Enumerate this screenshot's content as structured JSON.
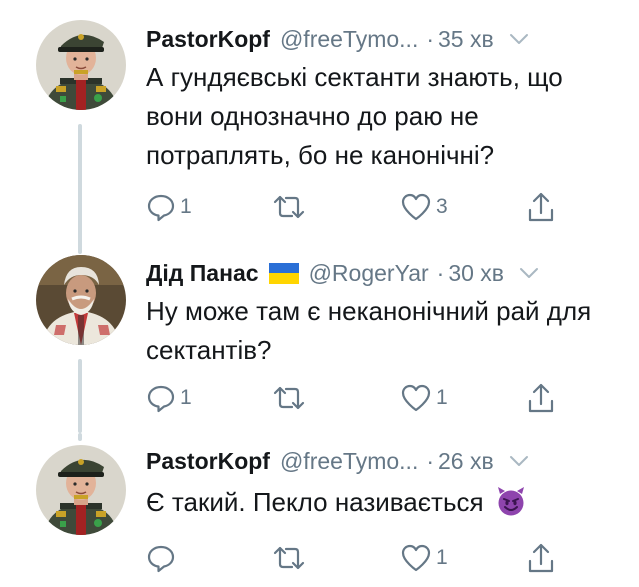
{
  "tweets": [
    {
      "display_name": "PastorKopf",
      "handle": "@freeTymo...",
      "separator": "·",
      "time": "35 хв",
      "text": "А гундяєвські сектанти знають, що вони однозначно до раю не потраплять, бо не канонічні?",
      "reply_count": "1",
      "retweet_count": "",
      "like_count": "3",
      "has_flag": false,
      "avatar": "uniformed-man-avatar"
    },
    {
      "display_name": "Дід Панас",
      "handle": "@RogerYar",
      "separator": "·",
      "time": "30 хв",
      "text": "Ну може там є неканонічний рай для сектантів?",
      "reply_count": "1",
      "retweet_count": "",
      "like_count": "1",
      "has_flag": true,
      "avatar": "old-man-avatar"
    },
    {
      "display_name": "PastorKopf",
      "handle": "@freeTymo...",
      "separator": "·",
      "time": "26 хв",
      "text": "Є такий. Пекло називається",
      "reply_count": "",
      "retweet_count": "",
      "like_count": "1",
      "has_flag": false,
      "avatar": "uniformed-man-avatar",
      "emoji": "smiling-devil-emoji"
    }
  ],
  "colors": {
    "text": "#14171a",
    "secondary": "#657786",
    "thread_line": "#cfd9de",
    "flag_blue": "#2a6fd6",
    "flag_yellow": "#ffd500",
    "devil_purple": "#8e44ad"
  },
  "icons": {
    "reply": "reply-icon",
    "retweet": "retweet-icon",
    "like": "heart-icon",
    "share": "share-icon",
    "caret": "chevron-down-icon"
  }
}
